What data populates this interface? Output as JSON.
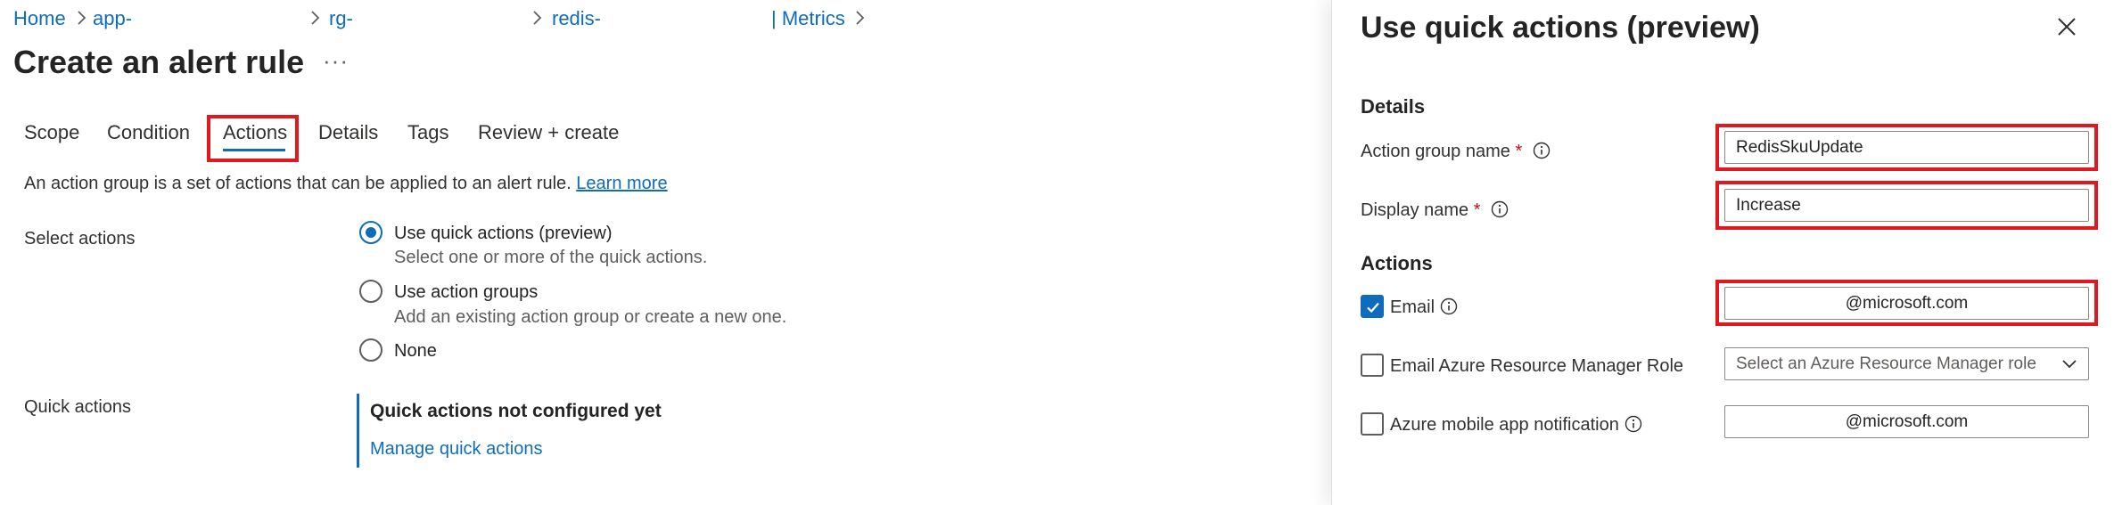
{
  "breadcrumb": {
    "home": "Home",
    "app": "app-",
    "rg": "rg-",
    "redis": "redis-",
    "metrics": "| Metrics"
  },
  "page": {
    "title": "Create an alert rule",
    "more": "···"
  },
  "tabs": [
    "Scope",
    "Condition",
    "Actions",
    "Details",
    "Tags",
    "Review + create"
  ],
  "active_tab": "Actions",
  "description": {
    "text": "An action group is a set of actions that can be applied to an alert rule.",
    "link": "Learn more"
  },
  "select_actions": {
    "label": "Select actions",
    "options": [
      {
        "label": "Use quick actions (preview)",
        "sub": "Select one or more of the quick actions.",
        "checked": true
      },
      {
        "label": "Use action groups",
        "sub": "Add an existing action group or create a new one.",
        "checked": false
      },
      {
        "label": "None",
        "sub": "",
        "checked": false
      }
    ]
  },
  "quick_actions": {
    "label": "Quick actions",
    "status": "Quick actions not configured yet",
    "manage_link": "Manage quick actions"
  },
  "panel": {
    "title": "Use quick actions (preview)",
    "details_heading": "Details",
    "action_group_name_label": "Action group name",
    "action_group_name_value": "RedisSkuUpdate",
    "display_name_label": "Display name",
    "display_name_value": "Increase",
    "required_marker": "*",
    "actions_heading": "Actions",
    "email_label": "Email",
    "email_checked": true,
    "email_value": "@microsoft.com",
    "arm_role_label": "Email Azure Resource Manager Role",
    "arm_role_checked": false,
    "arm_role_placeholder": "Select an Azure Resource Manager role",
    "mobile_label": "Azure mobile app notification",
    "mobile_checked": false,
    "mobile_value": "@microsoft.com"
  },
  "colors": {
    "accent": "#0f6cbd",
    "highlight": "#e0181f",
    "required": "#c50f1f"
  }
}
